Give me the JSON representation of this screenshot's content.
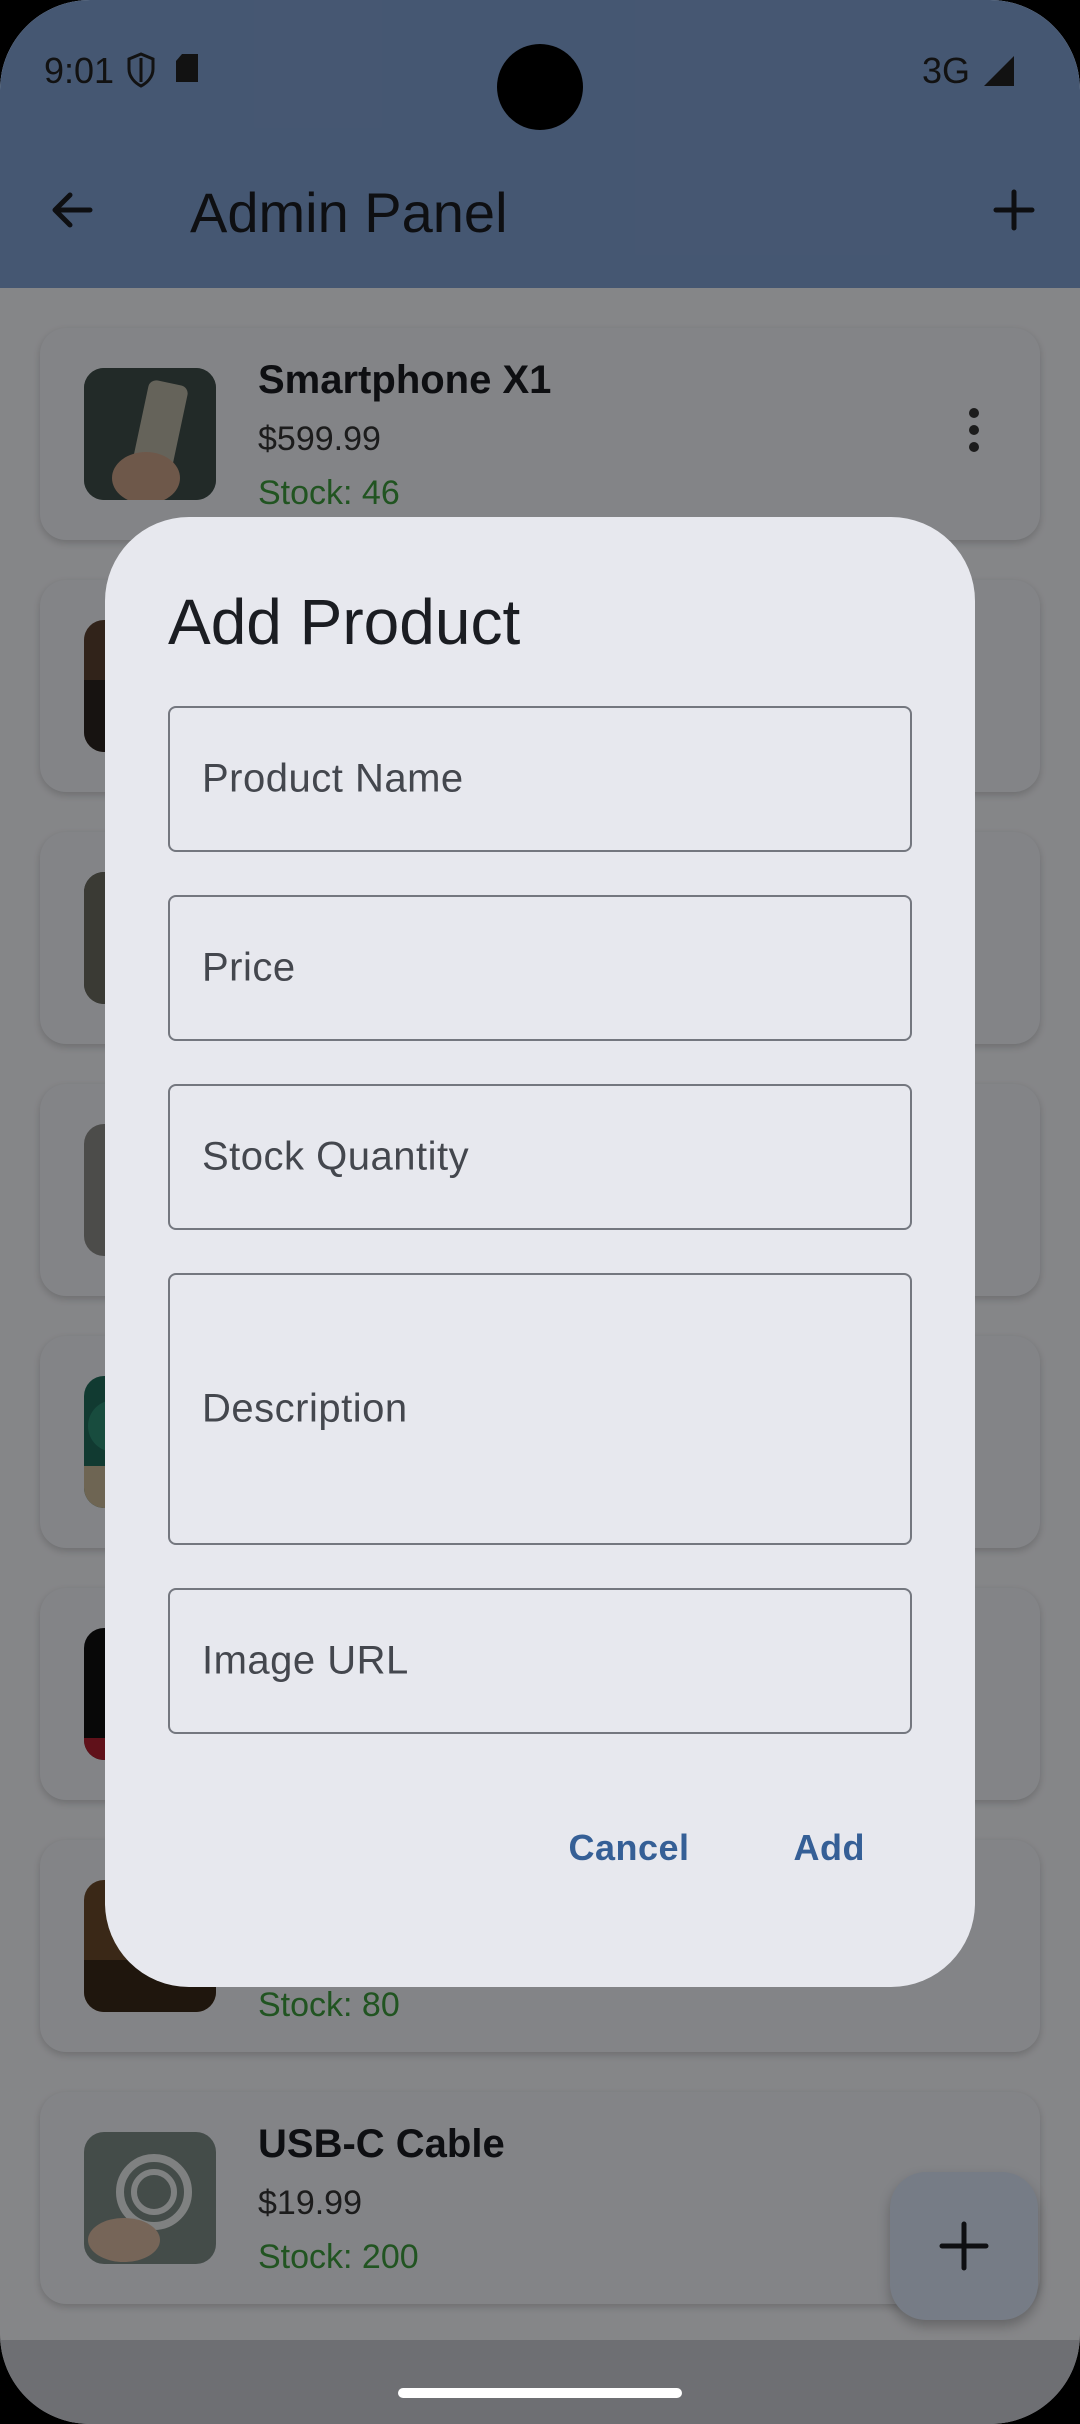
{
  "status_bar": {
    "time": "9:01",
    "network": "3G",
    "icons": [
      "shield-icon",
      "sd-card-icon",
      "signal-icon"
    ]
  },
  "app_bar": {
    "title": "Admin Panel",
    "back_icon": "arrow-left-icon",
    "add_icon": "plus-icon"
  },
  "products": [
    {
      "name": "Smartphone X1",
      "price": "$599.99",
      "stock": "Stock: 46"
    },
    {
      "name": "",
      "price": "",
      "stock": "Stock: 80"
    },
    {
      "name": "USB-C Cable",
      "price": "$19.99",
      "stock": "Stock: 200"
    }
  ],
  "dialog": {
    "title": "Add Product",
    "fields": {
      "product_name": "Product Name",
      "price": "Price",
      "stock_quantity": "Stock Quantity",
      "description": "Description",
      "image_url": "Image URL"
    },
    "cancel_label": "Cancel",
    "add_label": "Add"
  },
  "colors": {
    "app_bar": "#7f9fcf",
    "stock_green": "#3d9a3d",
    "accent": "#355f96",
    "dialog_bg": "#e7e8ee"
  }
}
